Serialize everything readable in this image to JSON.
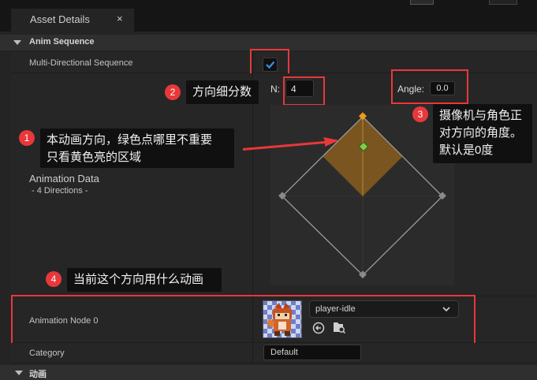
{
  "tab": {
    "title": "Asset Details",
    "close": "×"
  },
  "sections": {
    "anim_sequence": "Anim Sequence",
    "bottom": "动画"
  },
  "rows": {
    "multi_directional": "Multi-Directional Sequence",
    "multi_directional_checked": true,
    "animation_data": "Animation Data",
    "animation_data_sub": "- 4 Directions -",
    "animation_node": "Animation Node 0",
    "category": "Category",
    "category_value": "Default"
  },
  "controls": {
    "n_label": "N:",
    "n_value": "4",
    "angle_label": "Angle:",
    "angle_value": "0.0",
    "animation_select": "player-idle"
  },
  "callouts": [
    {
      "num": "1",
      "text": "本动画方向，绿色点哪里不重要\n只看黄色亮的区域"
    },
    {
      "num": "2",
      "text": "方向细分数"
    },
    {
      "num": "3",
      "text": "摄像机与角色正\n对方向的角度。\n默认是0度"
    },
    {
      "num": "4",
      "text": "当前这个方向用什么动画"
    }
  ],
  "colors": {
    "highlight": "#e8383a",
    "active_sector": "#7a5520",
    "direction_marker": "#f09a1a",
    "center_marker": "#7dcf4a"
  },
  "icons": [
    "close-icon",
    "collapse-triangle-icon",
    "checkmark-icon",
    "chevron-down-icon",
    "use-selected-asset-icon",
    "browse-asset-icon",
    "arrow-icon"
  ]
}
